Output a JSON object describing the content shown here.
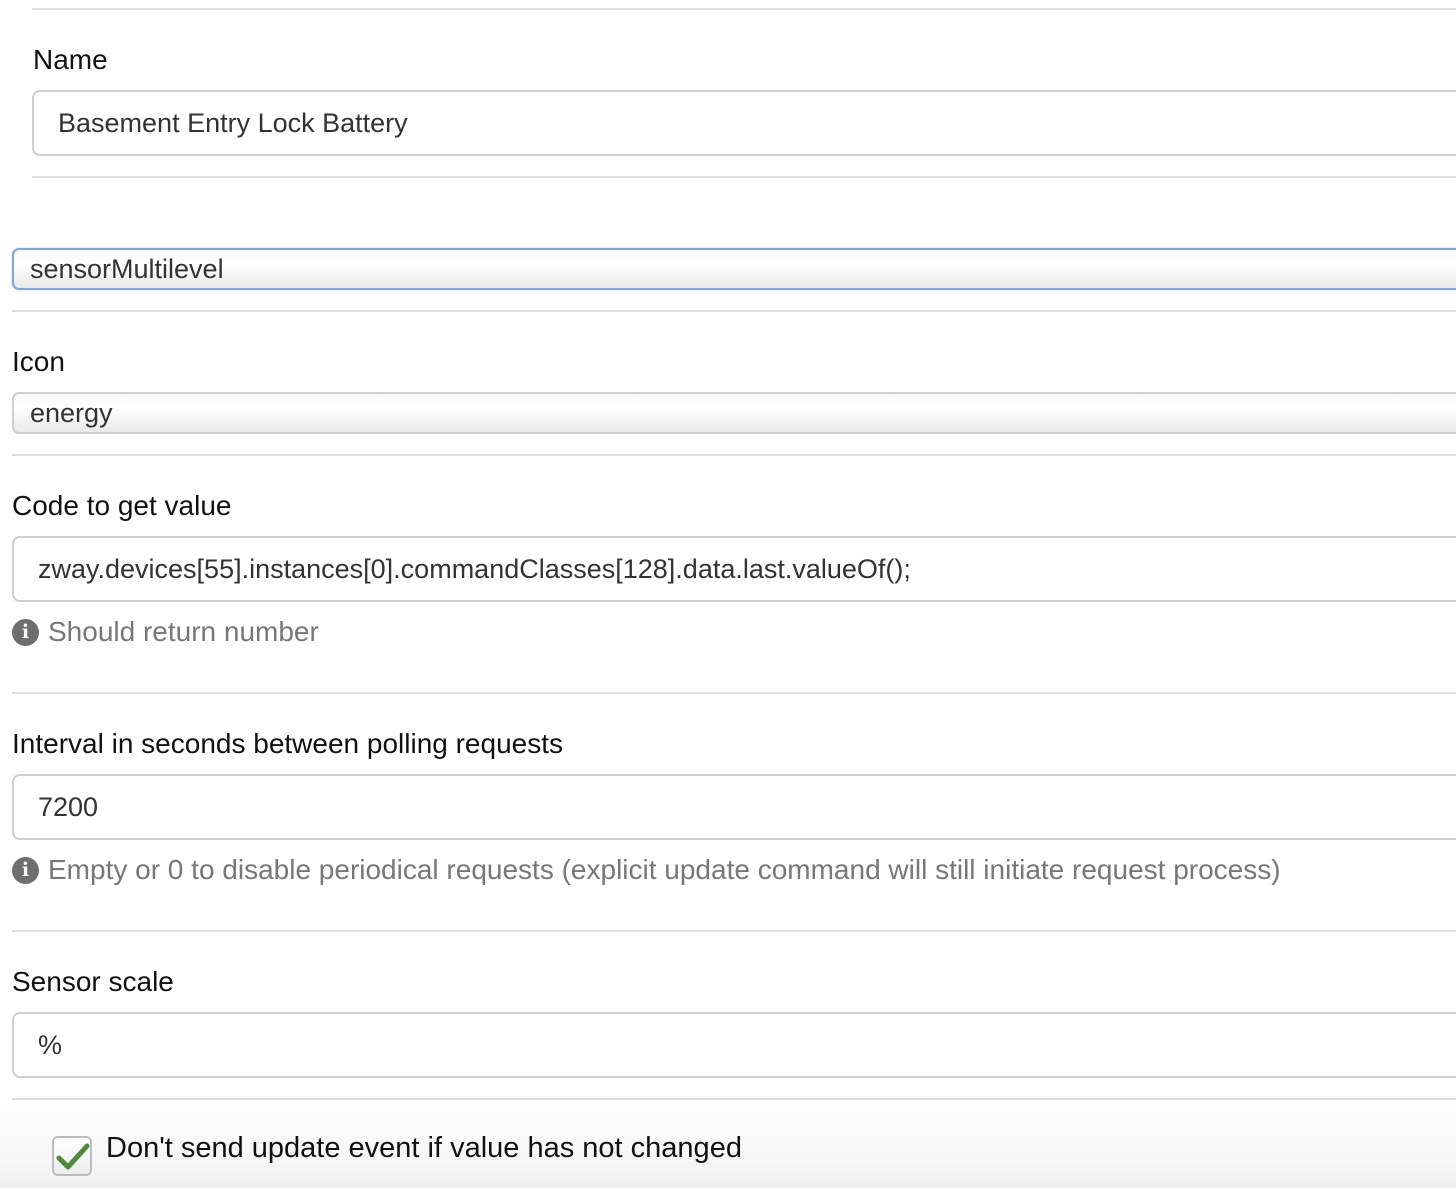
{
  "fields": {
    "name": {
      "label": "Name",
      "value": "Basement Entry Lock Battery"
    },
    "device_type": {
      "value": "sensorMultilevel"
    },
    "icon": {
      "label": "Icon",
      "value": "energy"
    },
    "code": {
      "label": "Code to get value",
      "value": "zway.devices[55].instances[0].commandClasses[128].data.last.valueOf();",
      "help": "Should return number"
    },
    "interval": {
      "label": "Interval in seconds between polling requests",
      "value": "7200",
      "help": "Empty or 0 to disable periodical requests (explicit update command will still initiate request process)"
    },
    "scale": {
      "label": "Sensor scale",
      "value": "%"
    },
    "skip_unchanged": {
      "label": "Don't send update event if value has not changed",
      "checked": true
    }
  },
  "icons": {
    "info": "info-icon",
    "check": "checkmark-icon"
  },
  "colors": {
    "focus_border": "#7aa7e0",
    "check_green": "#4e8a3a",
    "help_text": "#777777"
  }
}
